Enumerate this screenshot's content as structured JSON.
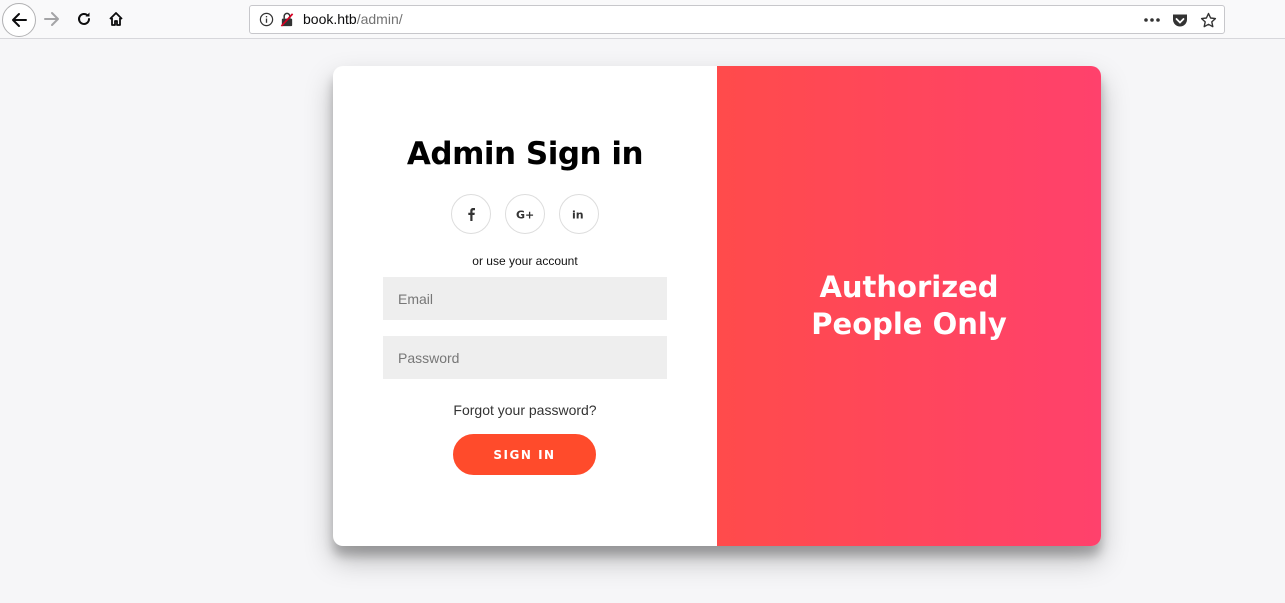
{
  "browser": {
    "url_host": "book.htb",
    "url_path": "/admin/",
    "icons": [
      "back-arrow-icon",
      "forward-arrow-icon",
      "reload-icon",
      "home-icon",
      "info-icon",
      "insecure-lock-icon",
      "more-dots-icon",
      "pocket-icon",
      "bookmark-star-icon"
    ]
  },
  "signin": {
    "title": "Admin Sign in",
    "socials": [
      {
        "name": "facebook",
        "glyph": "f"
      },
      {
        "name": "google-plus",
        "glyph": "G+"
      },
      {
        "name": "linkedin",
        "glyph": "in"
      }
    ],
    "or_text": "or use your account",
    "email_placeholder": "Email",
    "password_placeholder": "Password",
    "forgot_label": "Forgot your password?",
    "button_label": "SIGN IN"
  },
  "overlay": {
    "text": "Authorized People Only"
  },
  "colors": {
    "button": "#ff4b2b",
    "gradient_start": "#ff4b4b",
    "gradient_end": "#ff416c",
    "page_bg": "#f6f6f8"
  }
}
